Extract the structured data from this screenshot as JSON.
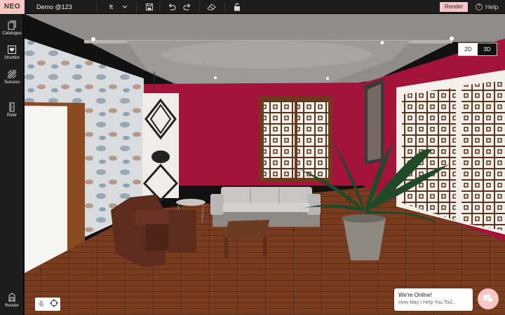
{
  "topbar": {
    "logo": "NEO",
    "project_name": "Demo @123",
    "unit": "ft",
    "render_label": "Render",
    "help_label": "Help"
  },
  "sidebar": {
    "items": [
      {
        "label": "Catalogue",
        "icon": "catalogue-icon"
      },
      {
        "label": "Shortlist",
        "icon": "shortlist-icon"
      },
      {
        "label": "Textures",
        "icon": "textures-icon"
      },
      {
        "label": "Ruler",
        "icon": "ruler-icon"
      },
      {
        "label": "Render",
        "icon": "render-icon"
      }
    ]
  },
  "viewport": {
    "view_modes": [
      "2D",
      "3D"
    ],
    "active_mode": "3D"
  },
  "chat": {
    "title": "We're Online!",
    "subtitle": "How May I Help You Tod..."
  },
  "colors": {
    "accent": "#f6c7c4",
    "wall": "#a3133a",
    "floor": "#7a3b1f",
    "bar": "#1d1d1d"
  }
}
